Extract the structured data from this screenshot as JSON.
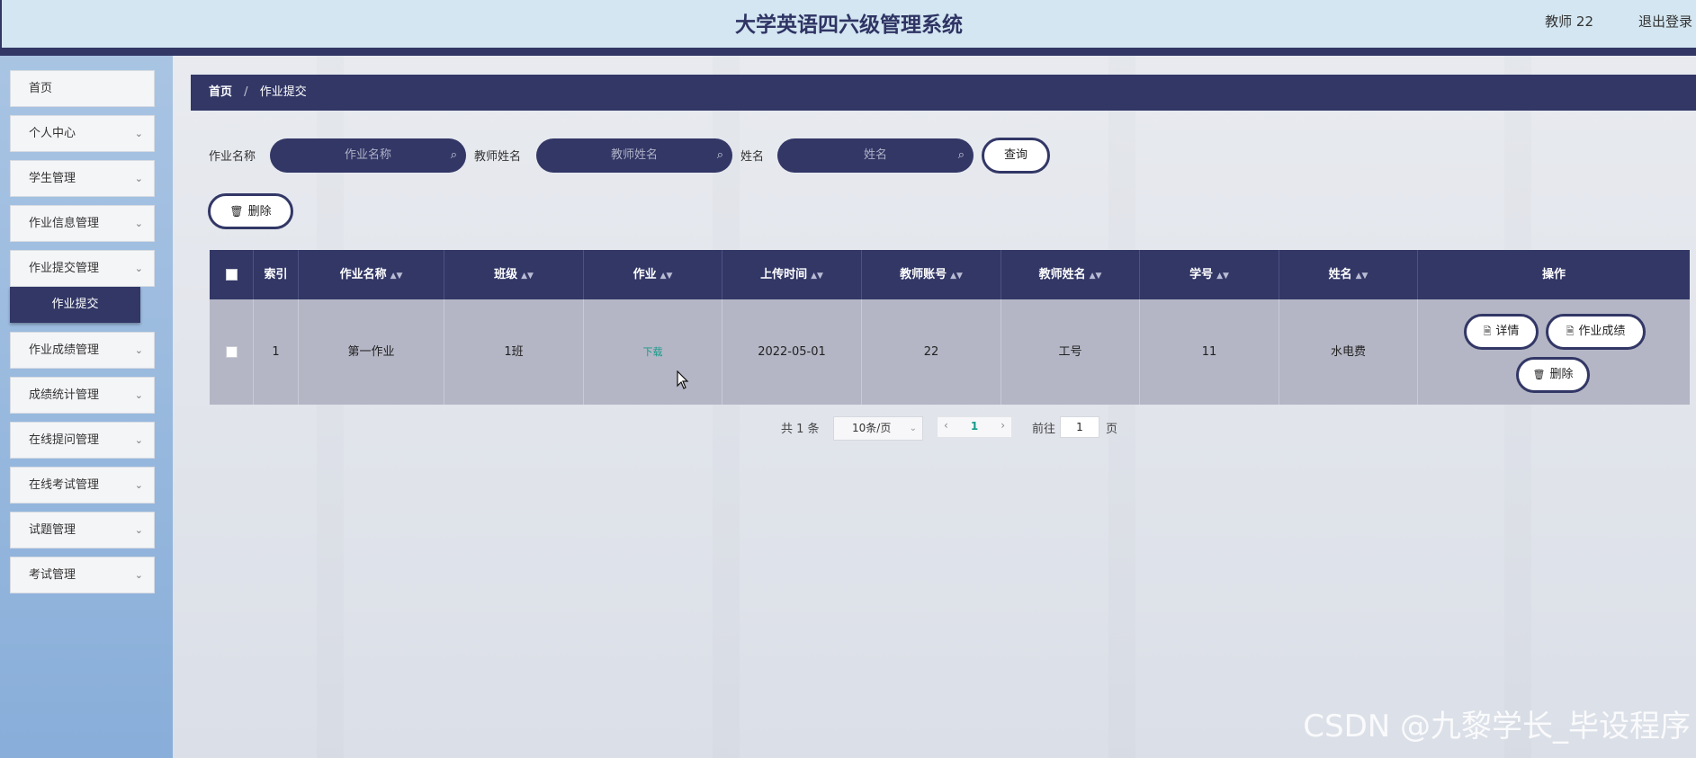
{
  "header": {
    "title": "大学英语四六级管理系统",
    "user": "教师 22",
    "logout": "退出登录"
  },
  "sidebar": {
    "items": [
      {
        "label": "首页",
        "chevron": ""
      },
      {
        "label": "个人中心",
        "chevron": "⌄"
      },
      {
        "label": "学生管理",
        "chevron": "⌄"
      },
      {
        "label": "作业信息管理",
        "chevron": "⌄"
      },
      {
        "label": "作业提交管理",
        "chevron": "⌄"
      },
      {
        "label": "作业成绩管理",
        "chevron": "⌄"
      },
      {
        "label": "成绩统计管理",
        "chevron": "⌄"
      },
      {
        "label": "在线提问管理",
        "chevron": "⌄"
      },
      {
        "label": "在线考试管理",
        "chevron": "⌄"
      },
      {
        "label": "试题管理",
        "chevron": "⌄"
      },
      {
        "label": "考试管理",
        "chevron": "⌄"
      }
    ],
    "submenu_active": "作业提交"
  },
  "breadcrumb": {
    "home": "首页",
    "separator": "/",
    "current": "作业提交"
  },
  "search": {
    "homework_label": "作业名称",
    "homework_placeholder": "作业名称",
    "teacher_label": "教师姓名",
    "teacher_placeholder": "教师姓名",
    "name_label": "姓名",
    "name_placeholder": "姓名",
    "search_icon": "search-icon",
    "query_button": "查询"
  },
  "toolbar": {
    "delete_label": "删除",
    "delete_icon": "trash-icon"
  },
  "table": {
    "columns": [
      "",
      "索引",
      "作业名称",
      "班级",
      "作业",
      "上传时间",
      "教师账号",
      "教师姓名",
      "学号",
      "姓名",
      "操作"
    ],
    "sort_indicator": "▲▼",
    "rows": [
      {
        "index": "1",
        "homework_name": "第一作业",
        "class": "1班",
        "homework": "下载",
        "upload_time": "2022-05-01",
        "teacher_account": "22",
        "teacher_name": "工号",
        "student_id": "11",
        "name": "水电费",
        "actions": {
          "detail": "详情",
          "grade": "作业成绩",
          "delete": "删除"
        }
      }
    ]
  },
  "pagination": {
    "total": "共 1 条",
    "page_size": "10条/页",
    "current_page": "1",
    "prev": "‹",
    "next": "›",
    "goto_label": "前往",
    "goto_value": "1",
    "goto_unit": "页"
  },
  "watermark": "CSDN @九黎学长_毕设程序",
  "colors": {
    "primary": "#323766",
    "header_bg": "#d3e6f1",
    "sidebar_bg": "#88aed9",
    "row_bg": "#b4b6c5",
    "link": "#169b8a"
  }
}
